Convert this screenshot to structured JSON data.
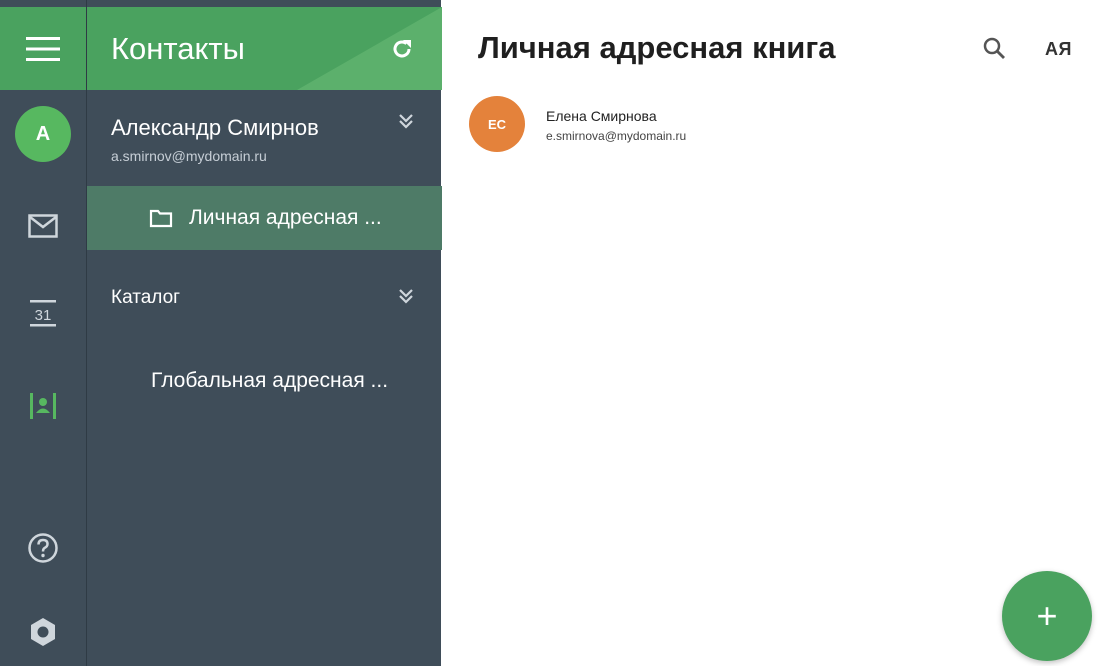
{
  "colors": {
    "accent": "#4aa25f",
    "sidebar": "#3f4d59",
    "selected_folder": "#4e7b67",
    "account_avatar": "#57b860",
    "contact_avatar": "#e4823b"
  },
  "rail": {
    "account_initial": "А",
    "icons": [
      "menu-icon",
      "mail-icon",
      "calendar-icon",
      "contacts-icon",
      "help-icon",
      "settings-icon"
    ],
    "calendar_day": "31"
  },
  "panel": {
    "title": "Контакты",
    "account": {
      "name": "Александр Смирнов",
      "email": "a.smirnov@mydomain.ru"
    },
    "personal_book": "Личная адресная ...",
    "catalog_title": "Каталог",
    "global_book": "Глобальная адресная ..."
  },
  "main": {
    "title": "Личная адресная книга",
    "sort_label": "АЯ",
    "contacts": [
      {
        "initials": "ЕС",
        "name": "Елена Смирнова",
        "email": "e.smirnova@mydomain.ru"
      }
    ],
    "add_label": "+"
  }
}
